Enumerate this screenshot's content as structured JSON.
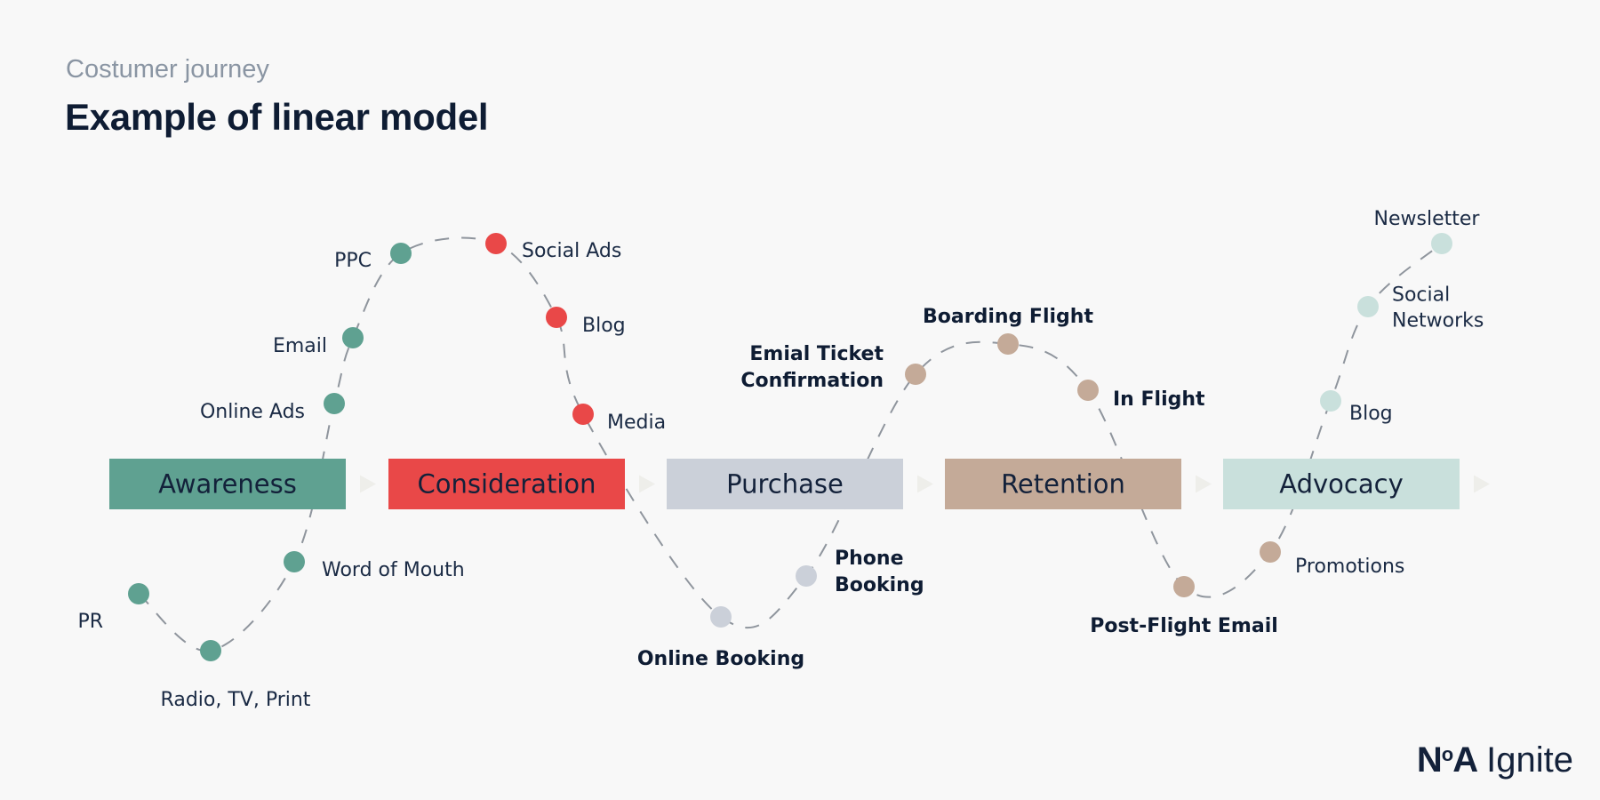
{
  "header": {
    "subtitle": "Costumer journey",
    "title": "Example of linear model"
  },
  "stages": [
    {
      "id": "awareness",
      "label": "Awareness",
      "color": "#5fa191"
    },
    {
      "id": "consideration",
      "label": "Consideration",
      "color": "#e94848"
    },
    {
      "id": "purchase",
      "label": "Purchase",
      "color": "#cbd0d9"
    },
    {
      "id": "retention",
      "label": "Retention",
      "color": "#c4aa98"
    },
    {
      "id": "advocacy",
      "label": "Advocacy",
      "color": "#c9e0dc"
    }
  ],
  "touchpoints": [
    {
      "label": [
        "PR"
      ],
      "stage": "awareness",
      "bold": false
    },
    {
      "label": [
        "Radio, TV, Print"
      ],
      "stage": "awareness",
      "bold": false
    },
    {
      "label": [
        "Word of Mouth"
      ],
      "stage": "awareness",
      "bold": false
    },
    {
      "label": [
        "Online Ads"
      ],
      "stage": "awareness",
      "bold": false
    },
    {
      "label": [
        "Email"
      ],
      "stage": "awareness",
      "bold": false
    },
    {
      "label": [
        "PPC"
      ],
      "stage": "awareness",
      "bold": false
    },
    {
      "label": [
        "Social Ads"
      ],
      "stage": "consideration",
      "bold": false
    },
    {
      "label": [
        "Blog"
      ],
      "stage": "consideration",
      "bold": false
    },
    {
      "label": [
        "Media"
      ],
      "stage": "consideration",
      "bold": false
    },
    {
      "label": [
        "Online Booking"
      ],
      "stage": "purchase",
      "bold": true
    },
    {
      "label": [
        "Phone",
        "Booking"
      ],
      "stage": "purchase",
      "bold": true
    },
    {
      "label": [
        "Emial Ticket",
        "Confirmation"
      ],
      "stage": "retention",
      "bold": true
    },
    {
      "label": [
        "Boarding Flight"
      ],
      "stage": "retention",
      "bold": true
    },
    {
      "label": [
        "In Flight"
      ],
      "stage": "retention",
      "bold": true
    },
    {
      "label": [
        "Post-Flight Email"
      ],
      "stage": "retention",
      "bold": true
    },
    {
      "label": [
        "Promotions"
      ],
      "stage": "retention",
      "bold": false
    },
    {
      "label": [
        "Blog"
      ],
      "stage": "advocacy",
      "bold": false
    },
    {
      "label": [
        "Social",
        "Networks"
      ],
      "stage": "advocacy",
      "bold": false
    },
    {
      "label": [
        "Newsletter"
      ],
      "stage": "advocacy",
      "bold": false
    }
  ],
  "colors": {
    "path": "#8f959d",
    "arrow": "#eeeeea"
  },
  "logo": {
    "brand": "N",
    "brand_mid": "o",
    "brand_end": "A",
    "product": "Ignite"
  }
}
